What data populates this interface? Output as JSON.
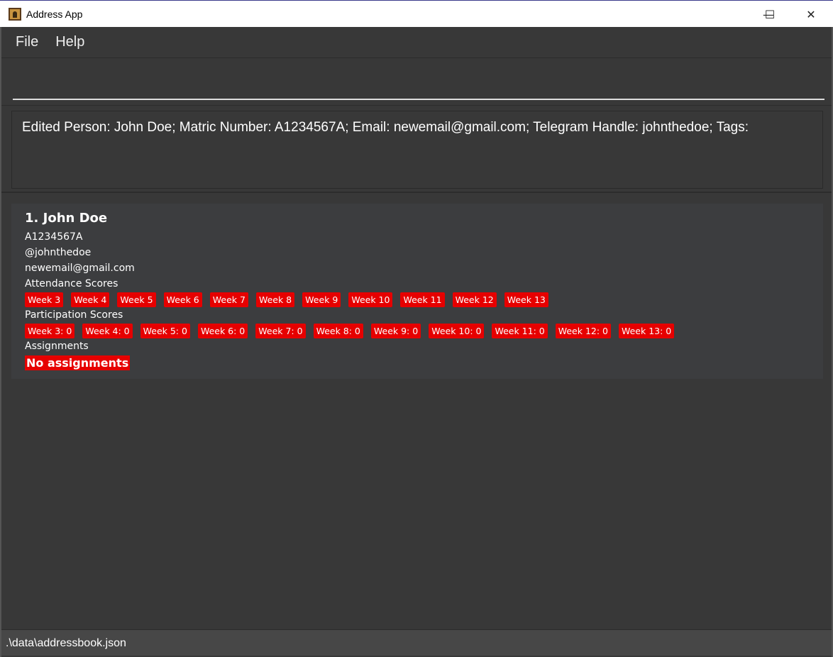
{
  "window": {
    "title": "Address App",
    "minimize": "—",
    "maximize": "☐",
    "close": "✕"
  },
  "menu": [
    "File",
    "Help"
  ],
  "command": {
    "value": "",
    "placeholder": ""
  },
  "result": "Edited Person: John Doe; Matric Number: A1234567A; Email: newemail@gmail.com; Telegram Handle: johnthedoe; Tags:",
  "person": {
    "index_name": "1.  John Doe",
    "matric": "A1234567A",
    "telegram": "@johnthedoe",
    "email": "newemail@gmail.com",
    "attendance_label": "Attendance Scores",
    "attendance": [
      "Week 3",
      "Week 4",
      "Week 5",
      "Week 6",
      "Week 7",
      "Week 8",
      "Week 9",
      "Week 10",
      "Week 11",
      "Week 12",
      "Week 13"
    ],
    "participation_label": "Participation Scores",
    "participation": [
      "Week 3: 0",
      "Week 4: 0",
      "Week 5: 0",
      "Week 6: 0",
      "Week 7: 0",
      "Week 8: 0",
      "Week 9: 0",
      "Week 10: 0",
      "Week 11: 0",
      "Week 12: 0",
      "Week 13: 0"
    ],
    "assignments_label": "Assignments",
    "assignments_empty": "No assignments"
  },
  "status": ".\\data\\addressbook.json",
  "colors": {
    "tag": "#e60000",
    "background": "#383838",
    "card": "#3c3d3f"
  }
}
